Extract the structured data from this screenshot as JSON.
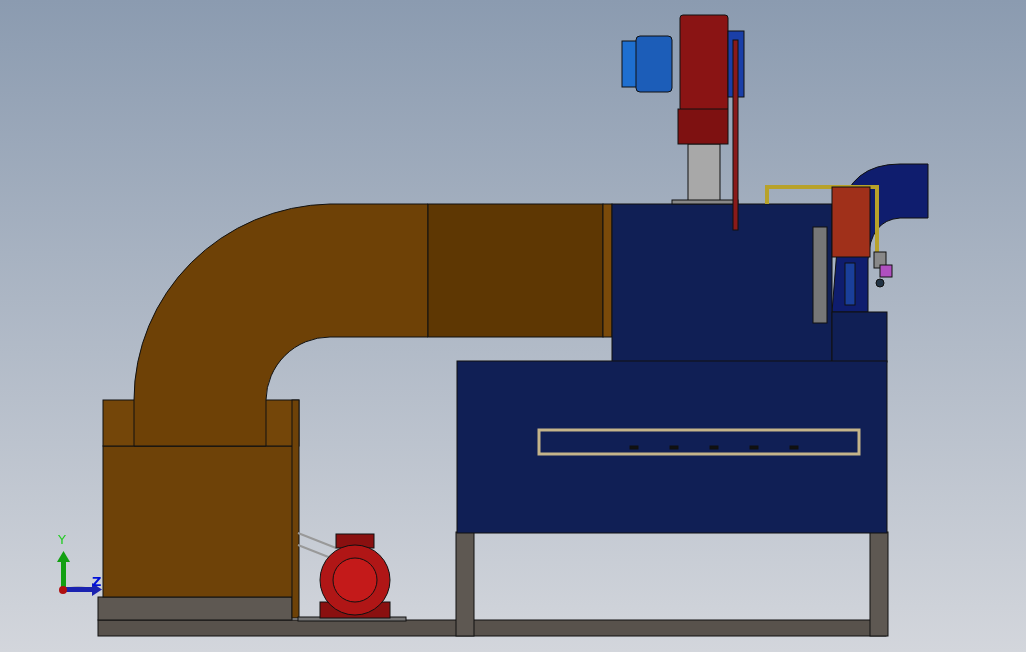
{
  "viewport": {
    "triad": {
      "y_label": "Y",
      "z_label": "Z"
    }
  }
}
